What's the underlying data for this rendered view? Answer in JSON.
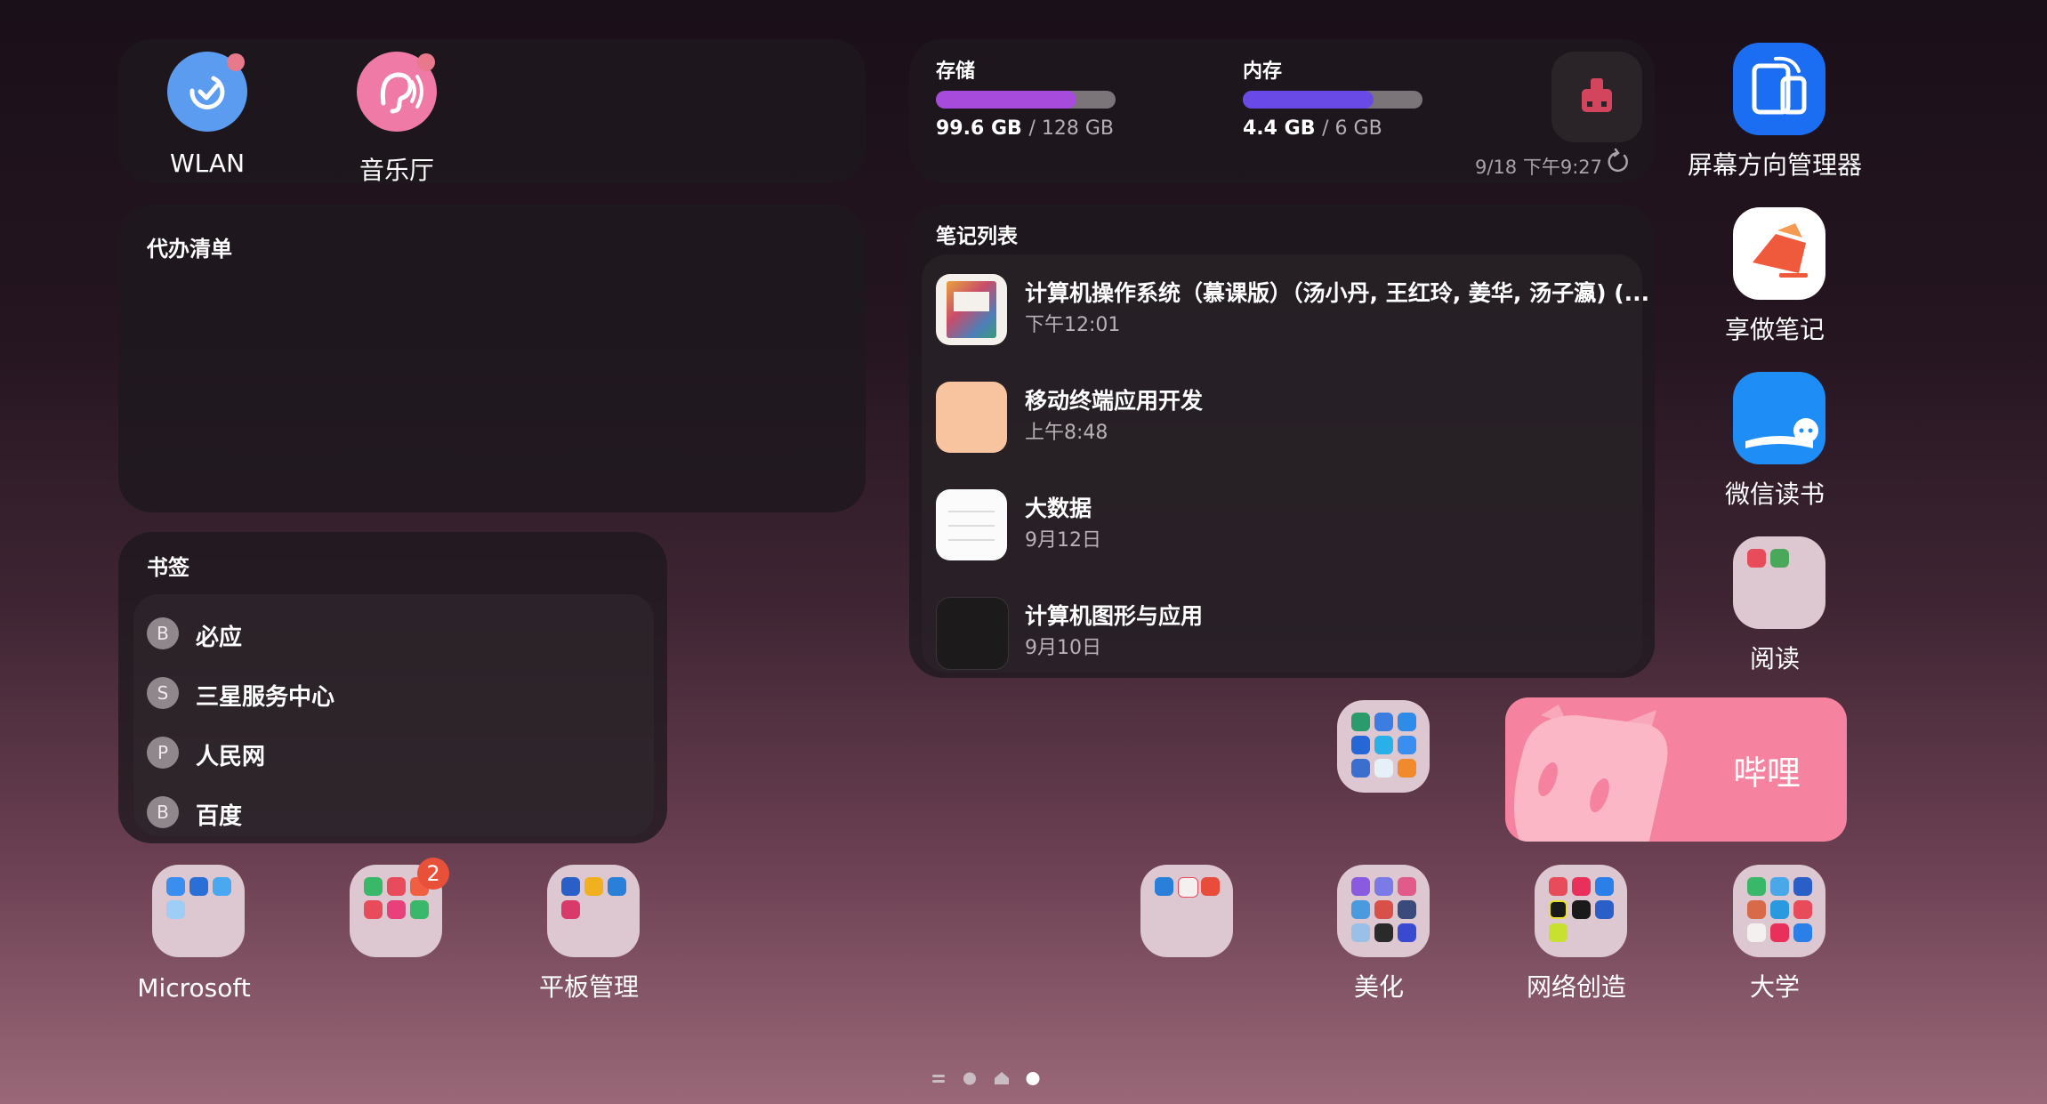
{
  "quick_toggles": [
    {
      "label": "WLAN",
      "icon": "wifi-check-icon",
      "color": "#5b9bf0"
    },
    {
      "label": "音乐厅",
      "icon": "ear-sound-icon",
      "color": "#ef7aa6"
    }
  ],
  "storage": {
    "storage_title": "存储",
    "storage_used": "99.6 GB",
    "storage_total": "/ 128 GB",
    "storage_fraction": 0.78,
    "memory_title": "内存",
    "memory_used": "4.4 GB",
    "memory_total": "/ 6 GB",
    "memory_fraction": 0.73,
    "updated": "9/18 下午9:27",
    "clean_icon": "broom-icon",
    "refresh_icon": "refresh-icon",
    "storage_color": "#a64bdc",
    "memory_color": "#6a4ae6"
  },
  "todo": {
    "title": "代办清单"
  },
  "notes": {
    "title": "笔记列表",
    "items": [
      {
        "title": "计算机操作系统（慕课版）（汤小丹, 王红玲, 姜华, 汤子瀛) (...",
        "date": "下午12:01"
      },
      {
        "title": "移动终端应用开发",
        "date": "上午8:48"
      },
      {
        "title": "大数据",
        "date": "9月12日"
      },
      {
        "title": "计算机图形与应用",
        "date": "9月10日"
      }
    ]
  },
  "bookmarks": {
    "title": "书签",
    "items": [
      {
        "letter": "B",
        "label": "必应"
      },
      {
        "letter": "S",
        "label": "三星服务中心"
      },
      {
        "letter": "P",
        "label": "人民网"
      },
      {
        "letter": "B",
        "label": "百度"
      }
    ]
  },
  "right_apps": [
    {
      "label": "屏幕方向管理器",
      "icon": "screen-rotation-icon"
    },
    {
      "label": "享做笔记",
      "icon": "notes-app-icon"
    },
    {
      "label": "微信读书",
      "icon": "wechat-read-icon"
    },
    {
      "label": "阅读",
      "icon": "reading-folder-icon"
    }
  ],
  "bilibili": {
    "label": "哔哩",
    "color": "#f5839f"
  },
  "bottom_apps": [
    {
      "label": "Microsoft"
    },
    {
      "label": "",
      "badge": "2"
    },
    {
      "label": "平板管理"
    },
    {
      "label": ""
    },
    {
      "label": "美化"
    },
    {
      "label": "网络创造"
    },
    {
      "label": "大学"
    }
  ],
  "page_indicator": {
    "pages": 3,
    "current": 3
  }
}
